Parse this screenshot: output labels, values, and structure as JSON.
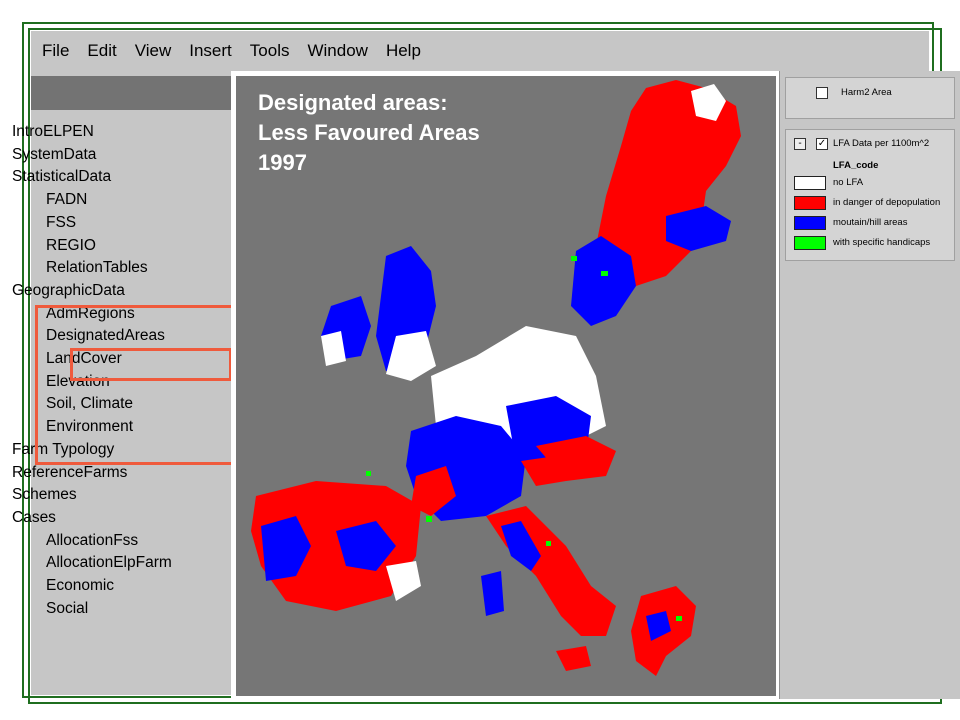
{
  "menu": [
    "File",
    "Edit",
    "View",
    "Insert",
    "Tools",
    "Window",
    "Help"
  ],
  "tree": [
    {
      "label": "IntroELPEN",
      "level": 0
    },
    {
      "label": "SystemData",
      "level": 0
    },
    {
      "label": "StatisticalData",
      "level": 0
    },
    {
      "label": "FADN",
      "level": 1
    },
    {
      "label": "FSS",
      "level": 1
    },
    {
      "label": "REGIO",
      "level": 1
    },
    {
      "label": "RelationTables",
      "level": 1
    },
    {
      "label": "GeographicData",
      "level": 0
    },
    {
      "label": "AdmRegions",
      "level": 1
    },
    {
      "label": "DesignatedAreas",
      "level": 1
    },
    {
      "label": "LandCover",
      "level": 1
    },
    {
      "label": "Elevation",
      "level": 1
    },
    {
      "label": "Soil, Climate",
      "level": 1
    },
    {
      "label": "Environment",
      "level": 1
    },
    {
      "label": "Farm Typology",
      "level": 0
    },
    {
      "label": "ReferenceFarms",
      "level": 0
    },
    {
      "label": "Schemes",
      "level": 0
    },
    {
      "label": "Cases",
      "level": 0
    },
    {
      "label": "AllocationFss",
      "level": 1
    },
    {
      "label": "AllocationElpFarm",
      "level": 1
    },
    {
      "label": "Economic",
      "level": 1
    },
    {
      "label": "Social",
      "level": 1
    }
  ],
  "map": {
    "title_lines": [
      "Designated areas:",
      "Less Favoured Areas",
      "1997"
    ]
  },
  "legend": {
    "layer1": {
      "label": "Harm2 Area",
      "checked": false
    },
    "layer2": {
      "label": "LFA Data per 1100m^2",
      "checked": true,
      "expand": "-"
    },
    "field": "LFA_code",
    "entries": [
      {
        "label": "no LFA",
        "color": "#ffffff"
      },
      {
        "label": "in danger of depopulation",
        "color": "#ff0000"
      },
      {
        "label": "moutain/hill areas",
        "color": "#0000ff"
      },
      {
        "label": "with specific handicaps",
        "color": "#00ff00"
      }
    ]
  },
  "colors": {
    "frame": "#1f6e1f",
    "highlight": "#ef5a3c",
    "map_background": "#767676"
  }
}
